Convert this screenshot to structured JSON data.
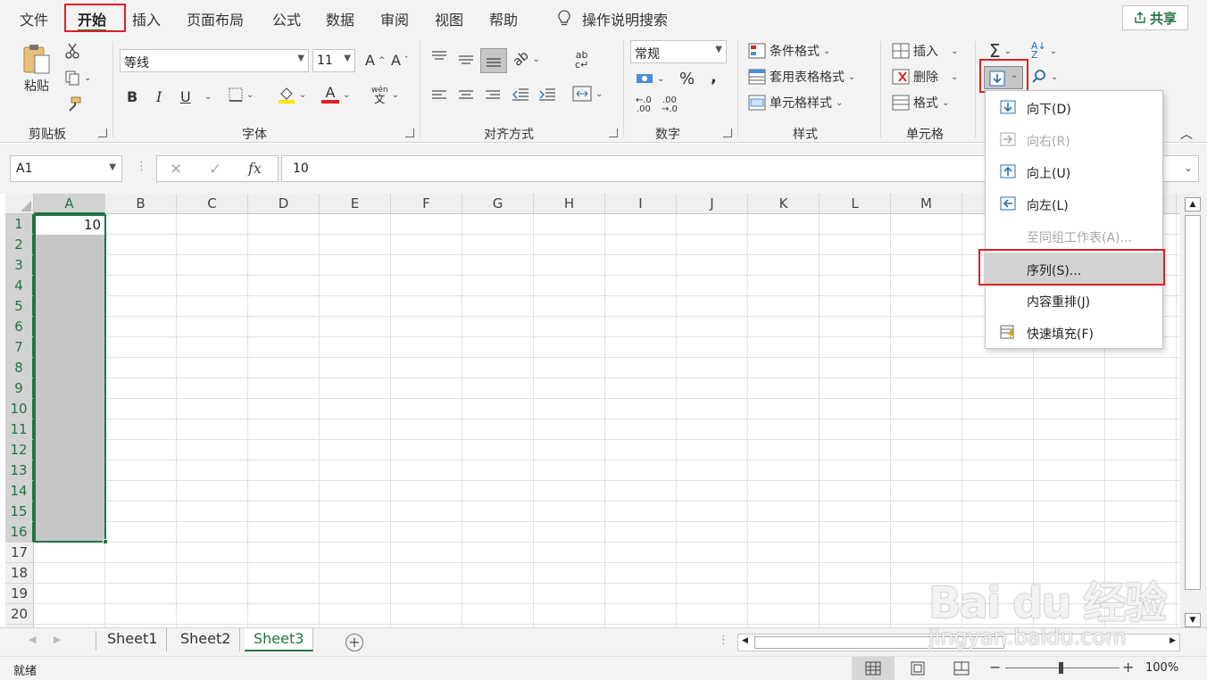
{
  "tabs": [
    "文件",
    "开始",
    "插入",
    "页面布局",
    "公式",
    "数据",
    "审阅",
    "视图",
    "帮助"
  ],
  "tell_me": "操作说明搜索",
  "share": "共享",
  "ribbon": {
    "clipboard": {
      "label": "剪贴板",
      "paste": "粘贴"
    },
    "font": {
      "label": "字体",
      "font_name": "等线",
      "font_size": "11",
      "bold": "B",
      "italic": "I",
      "underline": "U",
      "font_color_glyph": "A",
      "phonetic_top": "wén",
      "phonetic_bottom": "文"
    },
    "alignment": {
      "label": "对齐方式"
    },
    "number": {
      "label": "数字",
      "format": "常规",
      "percent": "%",
      "comma": ","
    },
    "styles": {
      "label": "样式",
      "conditional": "条件格式",
      "table": "套用表格格式",
      "cell_styles": "单元格样式"
    },
    "cells": {
      "label": "单元格",
      "insert": "插入",
      "delete": "删除",
      "format": "格式"
    },
    "editing": {
      "sum": "Σ"
    }
  },
  "formula_bar": {
    "name_box": "A1",
    "fx": "fx",
    "value": "10"
  },
  "grid": {
    "columns": [
      "A",
      "B",
      "C",
      "D",
      "E",
      "F",
      "G",
      "H",
      "I",
      "J",
      "K",
      "L",
      "M"
    ],
    "rows": [
      "1",
      "2",
      "3",
      "4",
      "5",
      "6",
      "7",
      "8",
      "9",
      "10",
      "11",
      "12",
      "13",
      "14",
      "15",
      "16",
      "17",
      "18",
      "19",
      "20"
    ],
    "a1_value": "10"
  },
  "fill_menu": [
    {
      "label": "向下(D)",
      "disabled": false
    },
    {
      "label": "向右(R)",
      "disabled": true
    },
    {
      "label": "向上(U)",
      "disabled": false
    },
    {
      "label": "向左(L)",
      "disabled": false
    },
    {
      "label": "至同组工作表(A)...",
      "disabled": true
    },
    {
      "label": "序列(S)...",
      "disabled": false
    },
    {
      "label": "内容重排(J)",
      "disabled": false
    },
    {
      "label": "快速填充(F)",
      "disabled": false
    }
  ],
  "sheets": [
    "Sheet1",
    "Sheet2",
    "Sheet3"
  ],
  "status": {
    "ready": "就绪",
    "zoom": "100%"
  },
  "watermark": {
    "brand": "Bai du 经验",
    "url": "jingyan.baidu.com"
  },
  "colors": {
    "excel_green": "#217346",
    "highlight_red": "#e02020"
  }
}
